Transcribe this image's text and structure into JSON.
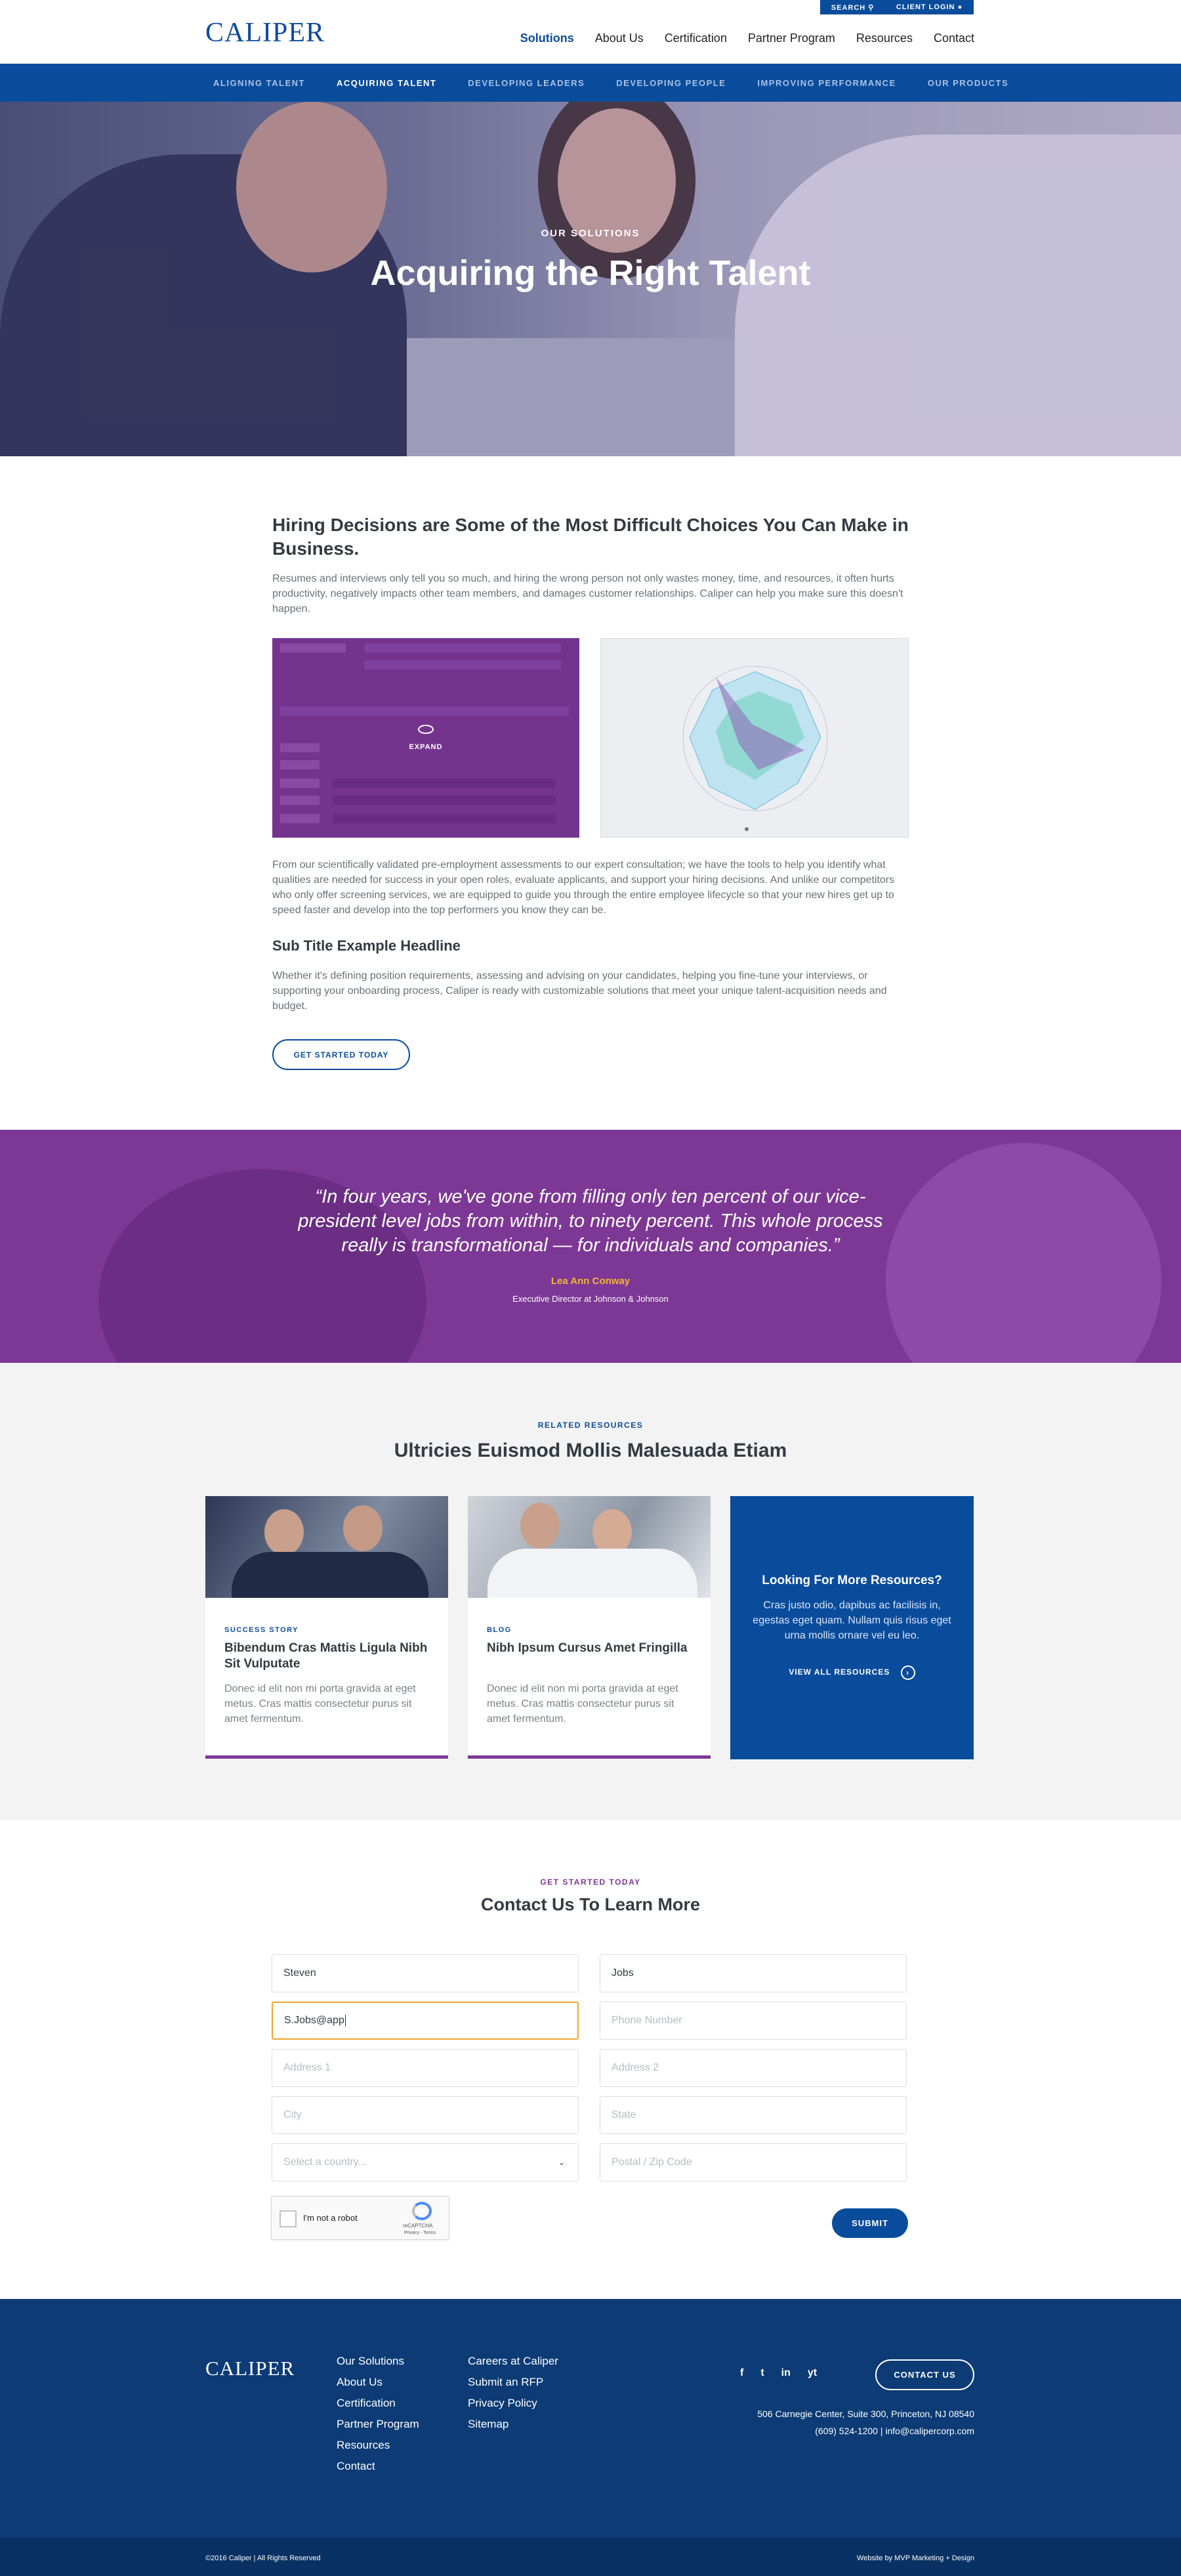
{
  "header": {
    "logo": "CALIPER",
    "utility": [
      "SEARCH",
      "CLIENT LOGIN"
    ],
    "nav": [
      "Solutions",
      "About Us",
      "Certification",
      "Partner Program",
      "Resources",
      "Contact"
    ],
    "active_nav": "Solutions"
  },
  "subnav": {
    "items": [
      "ALIGNING TALENT",
      "ACQUIRING TALENT",
      "DEVELOPING LEADERS",
      "DEVELOPING PEOPLE",
      "IMPROVING PERFORMANCE",
      "OUR PRODUCTS"
    ],
    "active": "ACQUIRING TALENT"
  },
  "hero": {
    "kicker": "OUR SOLUTIONS",
    "title": "Acquiring the Right Talent"
  },
  "intro": {
    "heading": "Hiring Decisions are Some of the Most Difficult Choices You Can Make in Business.",
    "paragraph1": "Resumes and interviews only tell you so much, and hiring the wrong person not only wastes money, time, and resources, it often hurts productivity, negatively impacts other team members, and damages customer relationships. Caliper can help you make sure this doesn't happen.",
    "expand_label": "EXPAND",
    "paragraph2": "From our scientifically validated pre-employment assessments to our expert consultation; we have the tools to help you identify what qualities are needed for success in your open roles, evaluate applicants, and support your hiring decisions. And unlike our competitors who only offer screening services, we are equipped to guide you through the entire employee lifecycle so that your new hires get up to speed faster and develop into the top performers you know they can be.",
    "subtitle": "Sub Title Example Headline",
    "paragraph3": "Whether it's defining position requirements, assessing and advising on your candidates, helping you fine-tune your interviews, or supporting your onboarding process, Caliper is ready with customizable solutions that meet your unique talent-acquisition needs and budget.",
    "cta": "GET STARTED TODAY"
  },
  "quote": {
    "text": "“In four years, we've gone from filling only ten percent of our vice-president level jobs from within, to ninety percent. This whole process really is transformational — for individuals and companies.”",
    "name": "Lea Ann Conway",
    "role": "Executive Director at Johnson & Johnson"
  },
  "resources": {
    "kicker": "RELATED RESOURCES",
    "title": "Ultricies Euismod Mollis Malesuada Etiam",
    "cards": [
      {
        "tag": "SUCCESS STORY",
        "title": "Bibendum Cras Mattis Ligula Nibh Sit Vulputate",
        "text": "Donec id elit non mi porta gravida at eget metus. Cras mattis consectetur purus sit amet fermentum."
      },
      {
        "tag": "BLOG",
        "title": "Nibh Ipsum Cursus Amet Fringilla",
        "text": "Donec id elit non mi porta gravida at eget metus. Cras mattis consectetur purus sit amet fermentum."
      }
    ],
    "more": {
      "title": "Looking For More Resources?",
      "text": "Cras justo odio, dapibus ac facilisis in, egestas eget quam. Nullam quis risus eget urna mollis ornare vel eu leo.",
      "link": "VIEW ALL RESOURCES"
    }
  },
  "contact": {
    "kicker": "GET STARTED TODAY",
    "title": "Contact Us To Learn More",
    "first_name": "Steven",
    "last_name": "Jobs",
    "email": "S.Jobs@app",
    "phone_placeholder": "Phone Number",
    "address1_placeholder": "Address 1",
    "address2_placeholder": "Address 2",
    "city_placeholder": "City",
    "state_placeholder": "State",
    "country_placeholder": "Select a country...",
    "zip_placeholder": "Postal / Zip Code",
    "captcha_label": "I'm not a robot",
    "captcha_brand": "reCAPTCHA",
    "captcha_links": "Privacy - Terms",
    "submit": "SUBMIT"
  },
  "footer": {
    "logo": "CALIPER",
    "col1": [
      "Our Solutions",
      "About Us",
      "Certification",
      "Partner Program",
      "Resources",
      "Contact"
    ],
    "col2": [
      "Careers at Caliper",
      "Submit an RFP",
      "Privacy  Policy",
      "Sitemap"
    ],
    "contact_button": "CONTACT US",
    "social": [
      "f",
      "t",
      "in",
      "yt"
    ],
    "address": "506 Carnegie Center, Suite 300, Princeton, NJ 08540",
    "phone_email": "(609) 524-1200  |  info@calipercorp.com",
    "copyright": "©2016 Caliper | All Rights Reserved",
    "credit": "Website by MVP Marketing + Design"
  },
  "colors": {
    "primary": "#0a4c9c",
    "purple": "#7d3895",
    "accent": "#f0a530",
    "footer": "#0c3b75"
  }
}
